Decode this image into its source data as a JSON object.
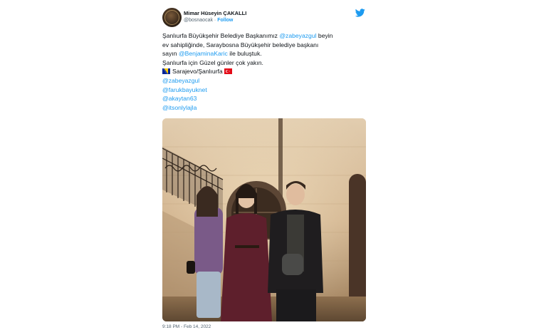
{
  "author": {
    "display_name": "Mimar Hüseyin ÇAKALLI",
    "handle": "@bosnaocak",
    "separator": " · ",
    "follow_label": "Follow"
  },
  "tweet": {
    "lines": [
      [
        {
          "t": "text",
          "v": "Şanlıurfa Büyükşehir Belediye Başkanımız  "
        },
        {
          "t": "mention",
          "v": "@zabeyazgul"
        },
        {
          "t": "text",
          "v": " beyin"
        }
      ],
      [
        {
          "t": "text",
          "v": "ev sahipliğinde, Saraybosna Büyükşehir belediye başkanı"
        }
      ],
      [
        {
          "t": "text",
          "v": "sayın "
        },
        {
          "t": "mention",
          "v": "@BenjaminaKaric"
        },
        {
          "t": "text",
          "v": "  ile buluştuk."
        }
      ],
      [
        {
          "t": "text",
          "v": "Şanlıurfa için Güzel günler çok yakın."
        }
      ],
      [
        {
          "t": "flag",
          "v": "bosnia"
        },
        {
          "t": "text",
          "v": "Sarajevo/Şanlıurfa "
        },
        {
          "t": "flag",
          "v": "turkey"
        }
      ],
      [
        {
          "t": "mention",
          "v": "@zabeyazgul"
        }
      ],
      [
        {
          "t": "mention",
          "v": "@farukbayuknet"
        }
      ],
      [
        {
          "t": "mention",
          "v": "@akaytan63"
        }
      ],
      [
        {
          "t": "mention",
          "v": "@itsonlylajla"
        }
      ]
    ]
  },
  "timestamp": "9:18 PM - Feb 14, 2022",
  "icons": {
    "twitter": "twitter-bird-icon",
    "flag_bosnia": "bosnia-flag-icon",
    "flag_turkey": "turkey-flag-icon"
  },
  "colors": {
    "link": "#1d9bf0",
    "text": "#0f1419",
    "muted": "#536471"
  }
}
